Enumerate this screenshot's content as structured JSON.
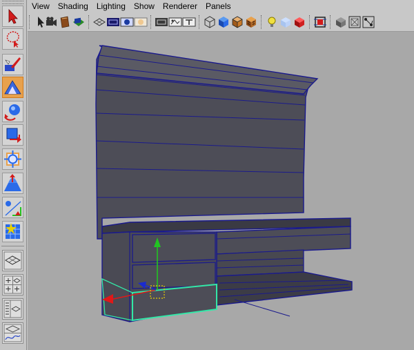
{
  "menu": {
    "items": [
      "View",
      "Shading",
      "Lighting",
      "Show",
      "Renderer",
      "Panels"
    ]
  },
  "colors": {
    "viewport_bg": "#a8a8a8",
    "wireframe": "#1a1a8c",
    "selection": "#33e8a8",
    "manipulator_y": "#22c422",
    "manipulator_x": "#e01818",
    "manipulator_z": "#1a2ad0",
    "pivot": "#e8d000",
    "active_tool": "#e8a14c"
  },
  "toolbox": {
    "tools": [
      "select-tool-icon",
      "lasso-tool-icon",
      "paint-select-tool-icon",
      "move-tool-icon",
      "rotate-tool-icon",
      "scale-tool-icon",
      "universal-manipulator-icon",
      "soft-modification-icon",
      "show-manipulator-icon",
      "last-tool-used-icon"
    ],
    "layouts": [
      "single-pane-layout-icon",
      "four-pane-layout-icon",
      "outliner-persp-layout-icon",
      "hypershade-layout-icon"
    ]
  },
  "iconbar": {
    "icons": [
      "select-camera-icon",
      "camera-attributes-icon",
      "bookmarks-icon",
      "image-plane-icon",
      "grid-icon",
      "film-gate-icon",
      "resolution-gate-icon",
      "gate-mask-icon",
      "field-chart-icon",
      "safe-action-icon",
      "safe-title-icon",
      "wireframe-icon",
      "smooth-shade-icon",
      "wireframe-on-shaded-icon",
      "textured-icon",
      "use-all-lights-icon",
      "shadows-icon",
      "x-ray-icon",
      "isolate-select-icon",
      "high-quality-icon",
      "backface-culling-icon",
      "xray-joints-icon"
    ]
  }
}
